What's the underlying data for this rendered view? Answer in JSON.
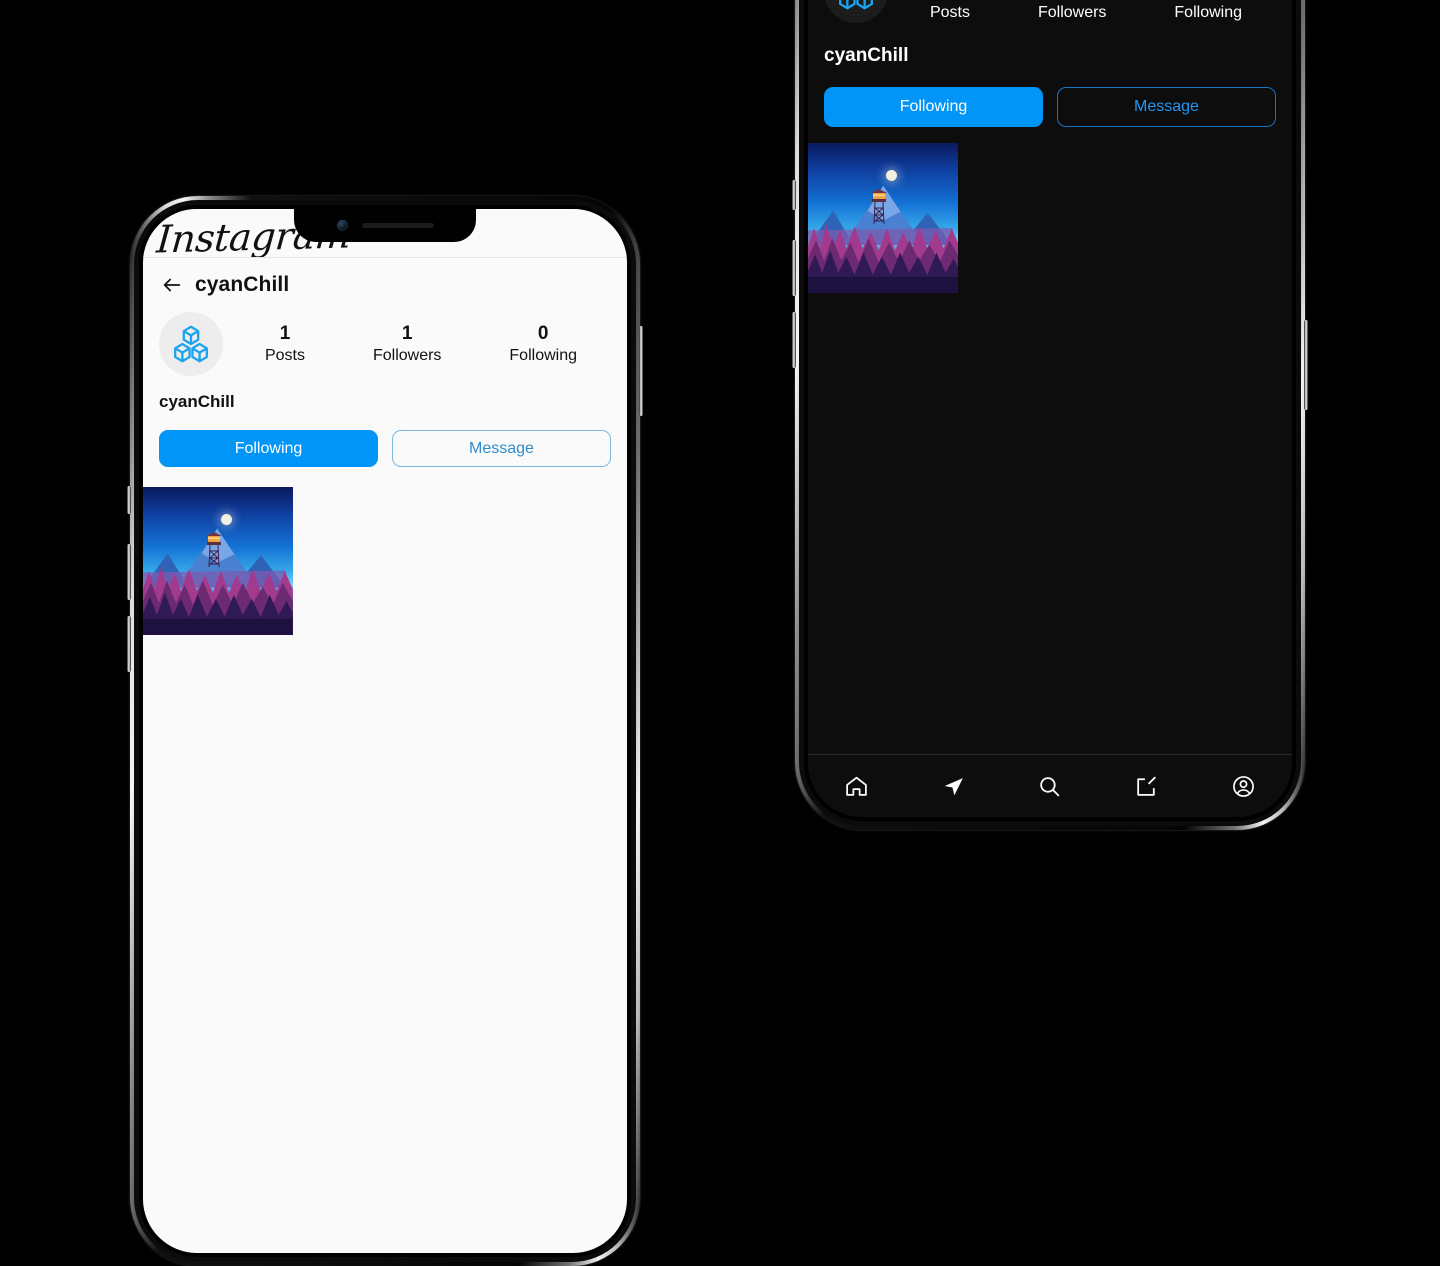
{
  "app": {
    "brand": "Instagram",
    "accent_color": "#0095f6",
    "light_bg": "#fafafa",
    "dark_bg": "#0d0d0d"
  },
  "phone_left": {
    "theme": "light",
    "logo": "Instagram",
    "header": {
      "back_icon": "back-arrow-icon",
      "title": "cyanChill"
    },
    "avatar_icon": "cubes-icon",
    "stats": [
      {
        "value": "1",
        "label": "Posts"
      },
      {
        "value": "1",
        "label": "Followers"
      },
      {
        "value": "0",
        "label": "Following"
      }
    ],
    "display_name": "cyanChill",
    "buttons": {
      "follow_label": "Following",
      "message_label": "Message"
    },
    "posts": [
      {
        "alt": "firewatch-lookout-tower-illustration"
      }
    ]
  },
  "phone_right": {
    "theme": "dark",
    "avatar_icon": "cubes-icon",
    "stats": [
      {
        "value": "",
        "label": "Posts"
      },
      {
        "value": "",
        "label": "Followers"
      },
      {
        "value": "",
        "label": "Following"
      }
    ],
    "display_name": "cyanChill",
    "buttons": {
      "follow_label": "Following",
      "message_label": "Message"
    },
    "posts": [
      {
        "alt": "firewatch-lookout-tower-illustration"
      }
    ],
    "bottom_nav": [
      {
        "icon": "home-icon",
        "label": "Home"
      },
      {
        "icon": "send-icon",
        "label": "Direct"
      },
      {
        "icon": "search-icon",
        "label": "Search"
      },
      {
        "icon": "compose-icon",
        "label": "Create"
      },
      {
        "icon": "profile-icon",
        "label": "Profile"
      }
    ]
  }
}
